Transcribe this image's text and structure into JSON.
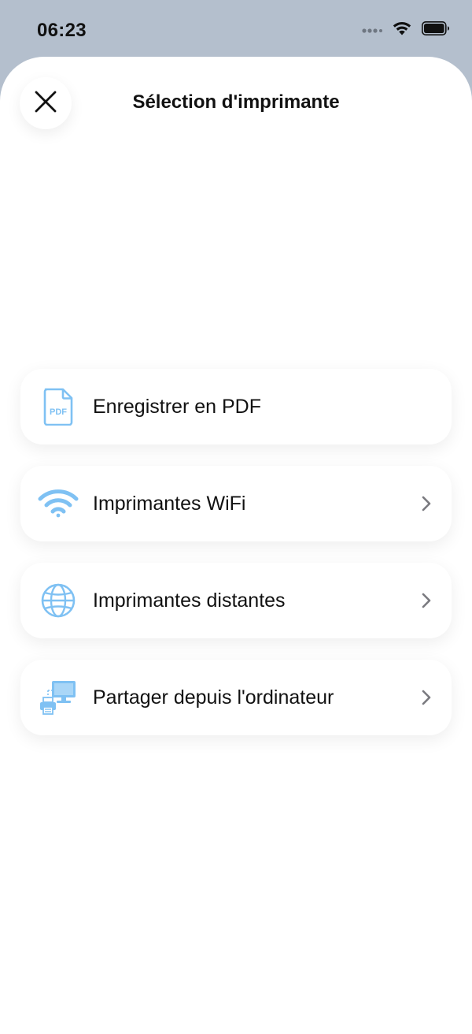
{
  "status_bar": {
    "time": "06:23"
  },
  "sheet": {
    "title": "Sélection d'imprimante"
  },
  "options": [
    {
      "label": "Enregistrer en PDF",
      "icon": "pdf-file-icon",
      "pdf_badge": "PDF",
      "has_chevron": false
    },
    {
      "label": "Imprimantes WiFi",
      "icon": "wifi-icon",
      "has_chevron": true
    },
    {
      "label": "Imprimantes distantes",
      "icon": "globe-icon",
      "has_chevron": true
    },
    {
      "label": "Partager depuis l'ordinateur",
      "icon": "computer-printer-icon",
      "has_chevron": true
    }
  ],
  "colors": {
    "accent_icon": "#7fc1f3",
    "status_bar_bg": "#b4bfcd",
    "chevron": "#7a7a7f"
  }
}
